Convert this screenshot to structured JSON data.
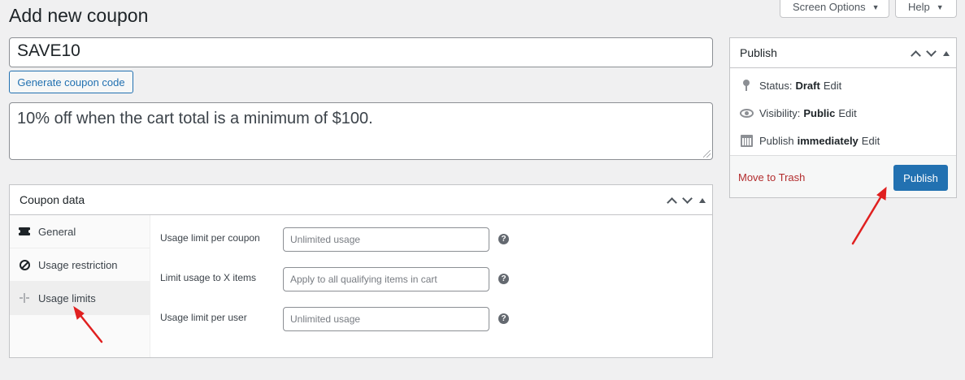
{
  "page": {
    "title": "Add new coupon"
  },
  "top_buttons": {
    "screen_options": "Screen Options",
    "help": "Help"
  },
  "coupon": {
    "code": "SAVE10",
    "generate_label": "Generate coupon code",
    "description": "10% off when the cart total is a minimum of $100."
  },
  "coupon_data": {
    "title": "Coupon data",
    "tabs": [
      {
        "label": "General",
        "icon": "ticket-icon"
      },
      {
        "label": "Usage restriction",
        "icon": "ban-icon"
      },
      {
        "label": "Usage limits",
        "icon": "usage-limits-icon",
        "active": true
      }
    ],
    "fields": [
      {
        "label": "Usage limit per coupon",
        "placeholder": "Unlimited usage"
      },
      {
        "label": "Limit usage to X items",
        "placeholder": "Apply to all qualifying items in cart"
      },
      {
        "label": "Usage limit per user",
        "placeholder": "Unlimited usage"
      }
    ],
    "help_glyph": "?"
  },
  "publish": {
    "title": "Publish",
    "status_label": "Status:",
    "status_value": "Draft",
    "visibility_label": "Visibility:",
    "visibility_value": "Public",
    "publish_label": "Publish",
    "publish_value": "immediately",
    "edit_label": "Edit",
    "trash_label": "Move to Trash",
    "publish_button": "Publish"
  },
  "colors": {
    "primary": "#2271b1",
    "danger": "#b32d2e",
    "annotation_arrow": "#e02020"
  }
}
